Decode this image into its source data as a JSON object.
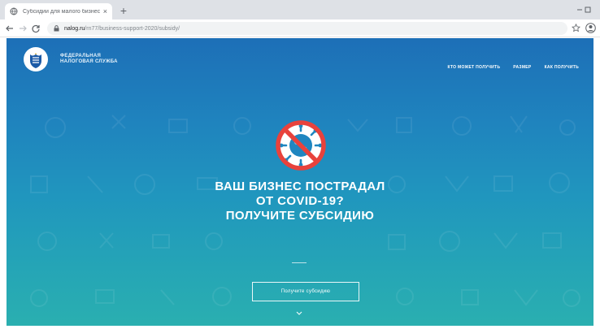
{
  "browser": {
    "tab": {
      "title": "Субсидии для малого бизнеса",
      "close": "×"
    },
    "new_tab": "+",
    "url": {
      "host": "nalog.ru",
      "path": "/rn77/business-support-2020/subsidy/"
    }
  },
  "site": {
    "brand": "ФЕДЕРАЛЬНАЯ НАЛОГОВАЯ СЛУЖБА",
    "nav": [
      "КТО МОЖЕТ ПОЛУЧИТЬ",
      "РАЗМЕР",
      "КАК ПОЛУЧИТЬ"
    ],
    "headline": [
      "ВАШ БИЗНЕС ПОСТРАДАЛ",
      "ОТ COVID-19?",
      "ПОЛУЧИТЕ СУБСИДИЮ"
    ],
    "cta": "Получите субсидию"
  },
  "icons": {
    "tab_favicon": "globe-icon",
    "back": "back-arrow-icon",
    "forward": "forward-arrow-icon",
    "reload": "reload-icon",
    "lock": "lock-icon",
    "star": "bookmark-star-icon",
    "profile": "profile-icon",
    "logo": "fns-emblem-icon",
    "virus": "no-virus-icon",
    "scroll": "chevron-down-icon"
  },
  "colors": {
    "accent_red": "#e8423c",
    "page_gradient_top": "#1d6fb7",
    "page_gradient_bottom": "#2aafb0",
    "chrome_tabstrip": "#dee1e6"
  }
}
